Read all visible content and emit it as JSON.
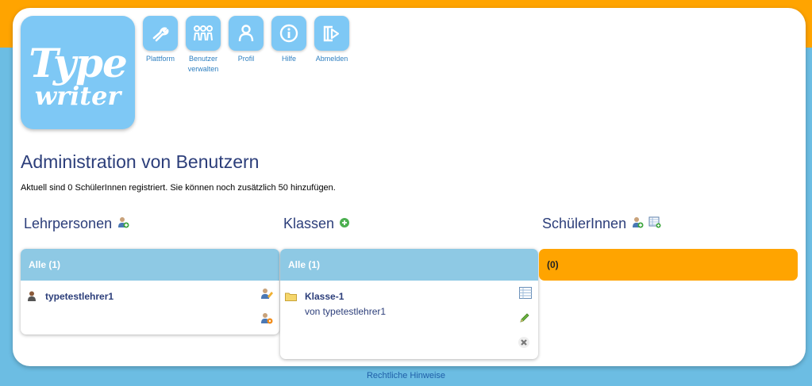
{
  "logo": {
    "line1": "Type",
    "line2": "writer"
  },
  "nav": [
    {
      "label": "Plattform",
      "icon": "wrench-icon"
    },
    {
      "label": "Benutzer verwalten",
      "icon": "users-icon"
    },
    {
      "label": "Profil",
      "icon": "person-icon"
    },
    {
      "label": "Hilfe",
      "icon": "info-icon"
    },
    {
      "label": "Abmelden",
      "icon": "logout-icon"
    }
  ],
  "page": {
    "title": "Administration von Benutzern",
    "info": "Aktuell sind 0 SchülerInnen registriert. Sie können noch zusätzlich 50 hinzufügen."
  },
  "columns": {
    "teachers": {
      "heading": "Lehrpersonen",
      "bar": "Alle (1)",
      "items": [
        {
          "name": "typetestlehrer1"
        }
      ]
    },
    "classes": {
      "heading": "Klassen",
      "bar": "Alle (1)",
      "items": [
        {
          "name": "Klasse-1",
          "owner": "von typetestlehrer1"
        }
      ]
    },
    "students": {
      "heading": "SchülerInnen",
      "bar": "(0)"
    }
  },
  "footer": {
    "link": "Rechtliche Hinweise"
  },
  "colors": {
    "orange": "#ffa400",
    "sky": "#6cbde3",
    "tile": "#7ec8f5",
    "bar": "#8ec9e4",
    "heading": "#2c3e7a"
  }
}
